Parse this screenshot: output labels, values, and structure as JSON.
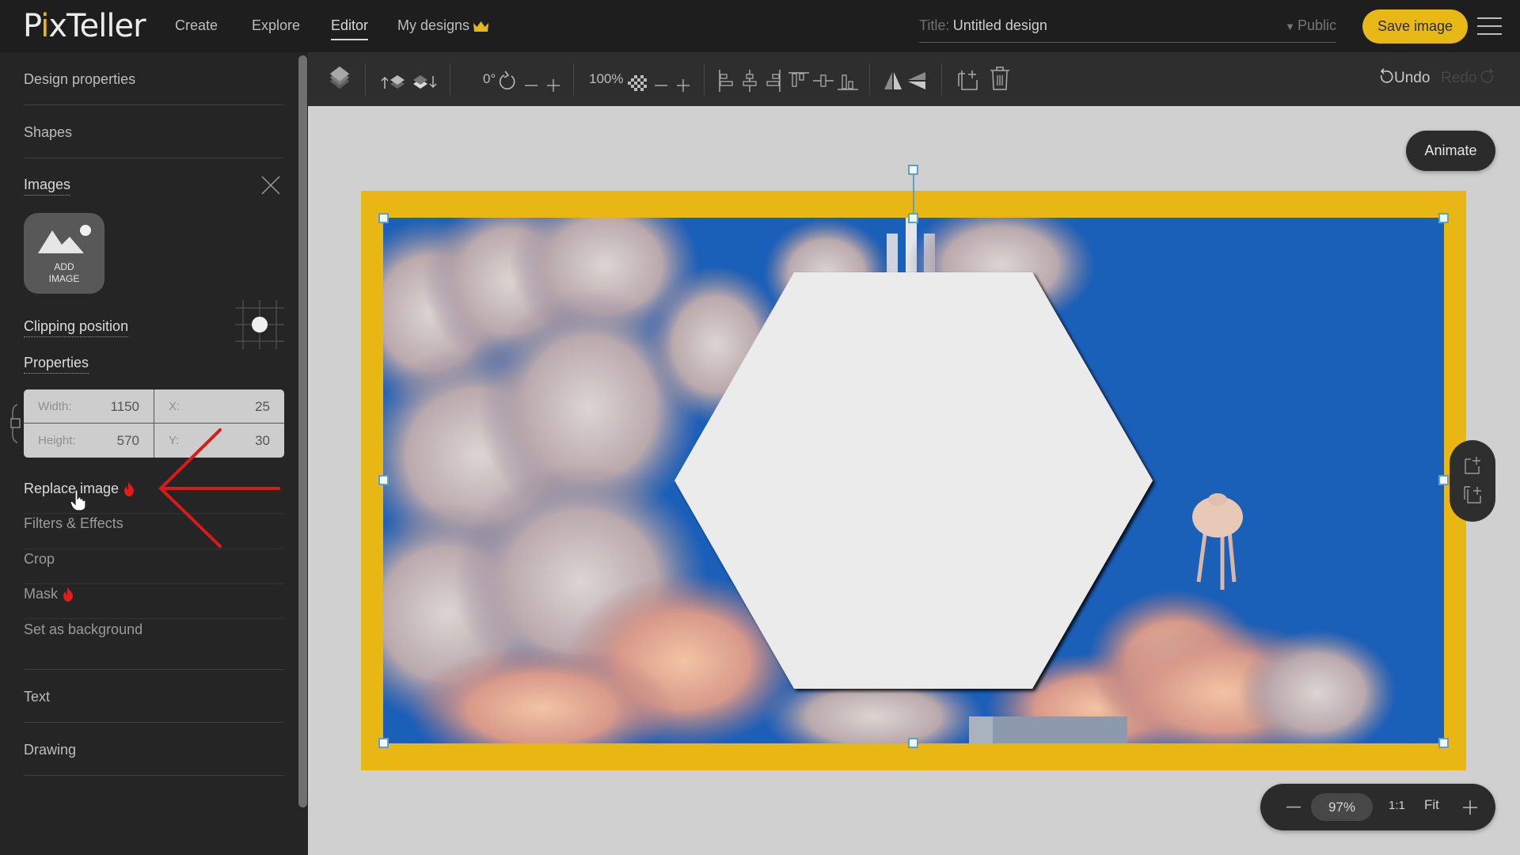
{
  "header": {
    "logo": {
      "part1": "P",
      "dot_letter": "i",
      "part2": "xTeller"
    },
    "nav": [
      {
        "label": "Create",
        "active": false
      },
      {
        "label": "Explore",
        "active": false
      },
      {
        "label": "Editor",
        "active": true
      },
      {
        "label": "My designs",
        "active": false,
        "icon": "crown-icon"
      }
    ],
    "title_label": "Title:",
    "title_value": "Untitled design",
    "visibility": "Public",
    "save_label": "Save image",
    "menu_icon": "hamburger-icon"
  },
  "sidebar": {
    "sections_top": [
      "Design properties",
      "Shapes"
    ],
    "images_heading": "Images",
    "add_image_label_line1": "ADD",
    "add_image_label_line2": "IMAGE",
    "clipping_label": "Clipping position",
    "properties_label": "Properties",
    "properties": {
      "width_label": "Width:",
      "width_value": "1150",
      "x_label": "X:",
      "x_value": "25",
      "height_label": "Height:",
      "height_value": "570",
      "y_label": "Y:",
      "y_value": "30"
    },
    "actions": [
      {
        "label": "Replace image",
        "hot": true
      },
      {
        "label": "Filters & Effects",
        "hot": false
      },
      {
        "label": "Crop",
        "hot": false
      },
      {
        "label": "Mask",
        "hot": true
      },
      {
        "label": "Set as background",
        "hot": false
      }
    ],
    "sections_bottom": [
      "Text",
      "Drawing"
    ]
  },
  "toolbar": {
    "rotation": "0°",
    "opacity": "100%",
    "undo_label": "Undo",
    "redo_label": "Redo"
  },
  "canvas": {
    "animate_label": "Animate",
    "frame_color": "#e8b714",
    "sky_color": "#1a5fb8",
    "hexagon_color": "#ebebeb"
  },
  "zoom_bar": {
    "zoom_value": "97%",
    "one_to_one": "1:1",
    "fit_label": "Fit"
  },
  "annotation": {
    "arrow_color": "#d91a1a"
  },
  "colors": {
    "accent": "#e8b916",
    "header_bg": "#1e1e1e",
    "sidebar_bg": "#252525",
    "toolbar_bg": "#2e2e2e"
  }
}
